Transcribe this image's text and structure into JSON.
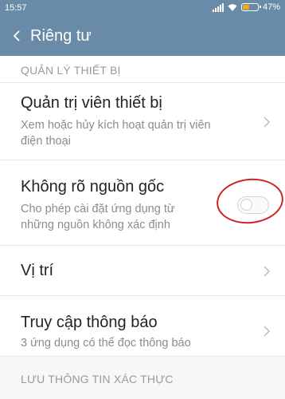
{
  "status_bar": {
    "time": "15:57",
    "battery_text": "47%",
    "battery_level": 0.47,
    "accent": "#f2a81d"
  },
  "app_bar": {
    "title": "Riêng tư",
    "back_icon": "chevron-left-icon",
    "background": "#6a8ba7"
  },
  "sections": [
    {
      "header": "QUẢN LÝ THIẾT BỊ"
    },
    {
      "header": "LƯU THÔNG TIN XÁC THỰC"
    }
  ],
  "rows": {
    "device_admin": {
      "title": "Quản trị viên thiết bị",
      "subtitle_line1": "Xem hoặc hủy kích hoạt quản trị viên",
      "subtitle_line2": "điện thoại",
      "icon": "chevron-right-icon"
    },
    "unknown_sources": {
      "title": "Không rõ nguồn gốc",
      "subtitle_line1": "Cho phép cài đặt ứng dụng từ",
      "subtitle_line2": "những nguồn không xác định",
      "toggle_on": false
    },
    "location": {
      "title": "Vị trí",
      "icon": "chevron-right-icon"
    },
    "notification_access": {
      "title": "Truy cập thông báo",
      "subtitle_line1": "3 ứng dụng có thể đọc thông báo",
      "icon": "chevron-right-icon"
    }
  }
}
